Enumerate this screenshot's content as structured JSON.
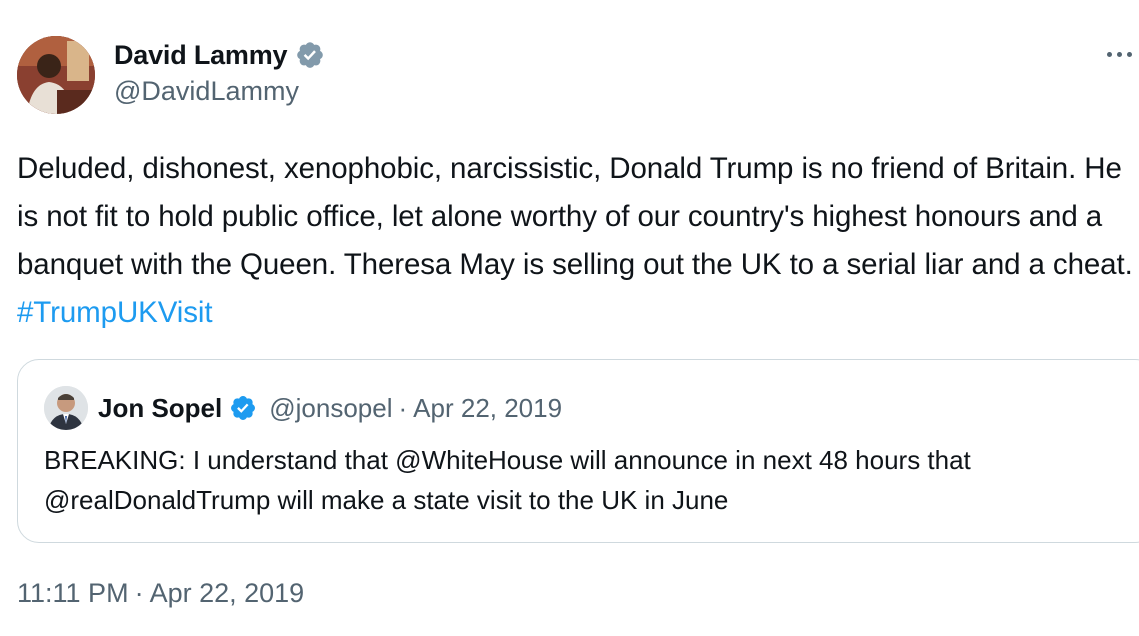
{
  "tweet": {
    "author_name": "David Lammy",
    "author_handle": "@DavidLammy",
    "verified_badge": "verified-grey-badge",
    "more_icon": "more-horizontal-icon",
    "body_text": "Deluded, dishonest, xenophobic, narcissistic, Donald Trump is no friend of Britain. He is not fit to hold public office, let alone worthy of our country's highest honours and a banquet with the Queen. Theresa May is selling out the UK to a serial liar and a cheat. ",
    "hashtag": "#TrumpUKVisit",
    "time": "11:11 PM",
    "separator": "·",
    "date": "Apr 22, 2019"
  },
  "quoted_tweet": {
    "author_name": "Jon Sopel",
    "author_handle": "@jonsopel",
    "verified_badge": "verified-blue-badge",
    "separator": "·",
    "date": "Apr 22, 2019",
    "text": "BREAKING: I understand that @WhiteHouse will announce in next 48 hours that @realDonaldTrump will make a state visit to the UK in June"
  },
  "colors": {
    "link_blue": "#1d9bf0",
    "secondary_text": "#536471",
    "border": "#cfd9de",
    "verified_grey": "#829aab"
  }
}
